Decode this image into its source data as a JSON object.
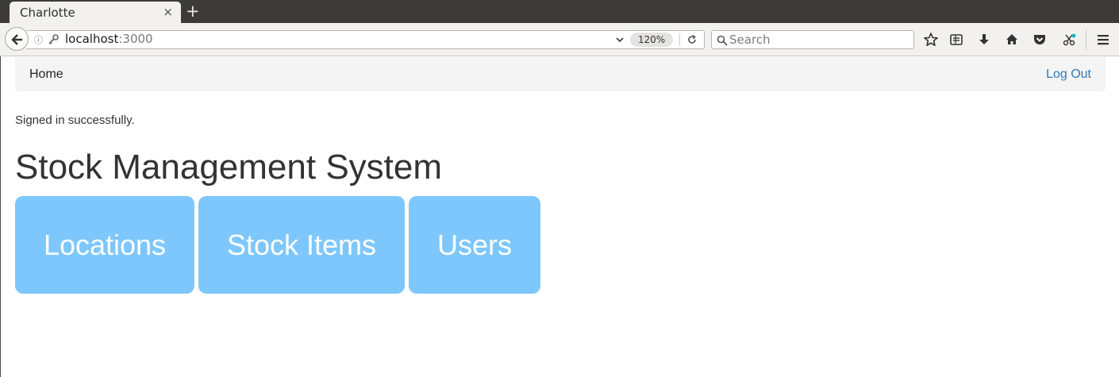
{
  "browser": {
    "tab_title": "Charlotte",
    "tab_close": "×",
    "new_tab": "+",
    "url_host": "localhost",
    "url_port": ":3000",
    "zoom": "120%",
    "search_placeholder": "Search",
    "icons": [
      "back-icon",
      "info-icon",
      "key-icon",
      "dropdown-icon",
      "reload-icon",
      "search-icon",
      "bookmark-star-icon",
      "reading-list-icon",
      "download-icon",
      "home-icon",
      "pocket-icon",
      "extension-icon",
      "menu-icon"
    ]
  },
  "nav": {
    "home": "Home",
    "logout": "Log Out"
  },
  "flash": "Signed in successfully.",
  "title": "Stock Management System",
  "tiles": [
    {
      "label": "Locations"
    },
    {
      "label": "Stock Items"
    },
    {
      "label": "Users"
    }
  ],
  "colors": {
    "tile_bg": "#7ec7fc",
    "link": "#2a7ab9",
    "nav_bg": "#f4f4f4"
  }
}
